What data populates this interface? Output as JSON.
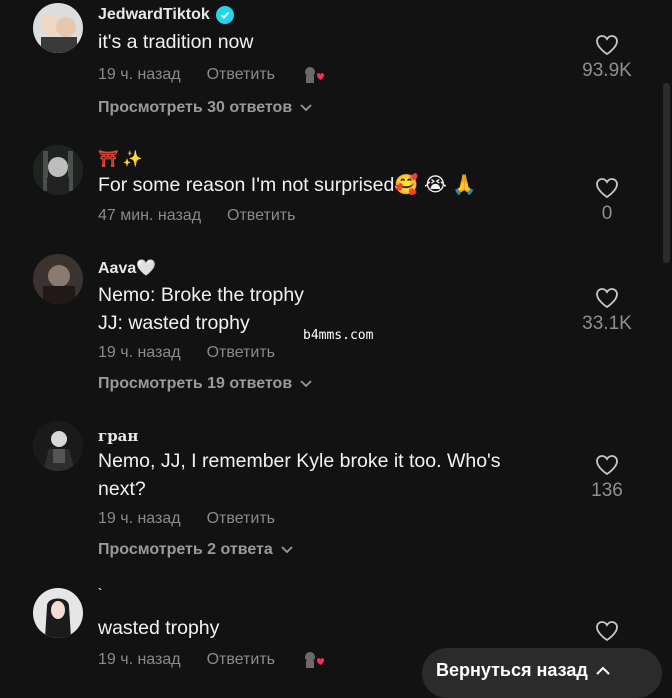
{
  "comments": [
    {
      "username": "JedwardTiktok",
      "verified": true,
      "text": "it's a tradition now",
      "time": "19 ч. назад",
      "reply_label": "Ответить",
      "creator_liked": true,
      "likes": "93.9K",
      "view_replies": "Просмотреть 30 ответов"
    },
    {
      "username": "⛩ ✨",
      "text": "For some reason I'm not surprised🥰 😭 🙏",
      "time": "47 мин. назад",
      "reply_label": "Ответить",
      "likes": "0"
    },
    {
      "username": "Aava🤍",
      "text_line1": "Nemo: Broke the trophy",
      "text_line2": "JJ: wasted trophy",
      "time": "19 ч. назад",
      "reply_label": "Ответить",
      "likes": "33.1K",
      "view_replies": "Просмотреть 19 ответов"
    },
    {
      "username": "гран",
      "text_line1": "Nemo, JJ, I remember Kyle broke it too. Who's",
      "text_line2": "next?",
      "time": "19 ч. назад",
      "reply_label": "Ответить",
      "likes": "136",
      "view_replies": "Просмотреть 2 ответа"
    },
    {
      "username": "`",
      "text": "wasted trophy",
      "time": "19 ч. назад",
      "reply_label": "Ответить",
      "creator_liked": true
    }
  ],
  "watermark": "b4mms.com",
  "back_to_top_label": "Вернуться назад",
  "colors": {
    "background": "#121212",
    "verified_badge": "#20d5ec",
    "muted_text": "#8a8a8a",
    "creator_heart": "#fe2c55"
  },
  "icons": [
    "verified-icon",
    "heart-outline-icon",
    "creator-liked-icon",
    "chevron-down-icon",
    "chevron-up-icon"
  ]
}
